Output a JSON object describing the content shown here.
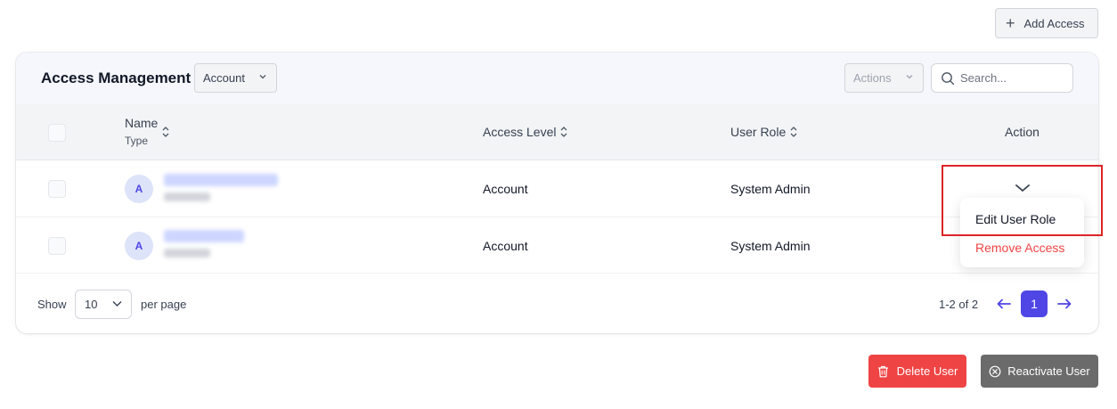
{
  "top_actions": {
    "add_access_label": "Add Access"
  },
  "card": {
    "title": "Access Management",
    "scope_select_value": "Account",
    "actions_select_value": "Actions",
    "search_placeholder": "Search..."
  },
  "table": {
    "columns": {
      "name": "Name",
      "name_sub": "Type",
      "access_level": "Access Level",
      "user_role": "User Role",
      "action": "Action"
    },
    "rows": [
      {
        "avatar_initial": "A",
        "access_level": "Account",
        "user_role": "System Admin"
      },
      {
        "avatar_initial": "A",
        "access_level": "Account",
        "user_role": "System Admin"
      }
    ]
  },
  "row_menu": {
    "edit_label": "Edit User Role",
    "remove_label": "Remove Access"
  },
  "pagination": {
    "show_label": "Show",
    "page_size": "10",
    "per_page_label": "per page",
    "range_text": "1-2 of 2",
    "current_page": "1"
  },
  "footer_buttons": {
    "delete_label": "Delete User",
    "reactivate_label": "Reactivate User"
  },
  "colors": {
    "primary": "#4f46e5",
    "danger": "#ef4444",
    "highlight": "#dc2626"
  }
}
